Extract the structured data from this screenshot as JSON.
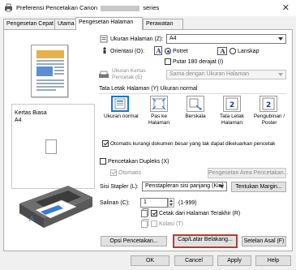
{
  "window": {
    "title_prefix": "Preferensi Pencetakan Canon",
    "title_suffix": "series",
    "close_glyph": "✕"
  },
  "tabs": [
    {
      "label": "Pengesetan Cepat"
    },
    {
      "label": "Utama"
    },
    {
      "label": "Pengesetan Halaman"
    },
    {
      "label": "Perawatan"
    }
  ],
  "preview": {
    "media_line1": "Kertas Biasa",
    "media_line2": "A4"
  },
  "page_setup": {
    "page_size_label": "Ukuran Halaman",
    "page_size_key": "(Z):",
    "page_size_value": "A4",
    "orientation_label": "Orientasi",
    "orientation_key": "(O):",
    "portrait_label": "Potret",
    "landscape_label": "Lanskap",
    "rotate_label": "Putar 180 derajat",
    "rotate_key": "(I)",
    "paper_size_label1": "Ukuran Kertas",
    "paper_size_label2": "Pencetak (E)",
    "paper_size_value": "Sama dengan Ukuran Halaman",
    "layout_heading": "Tata Letak Halaman",
    "layout_key": "(Y)",
    "layout_current": "Ukuran normal",
    "layouts": [
      {
        "label": "Ukuran normal",
        "label2": ""
      },
      {
        "label": "Pas ke",
        "label2": "Halaman"
      },
      {
        "label": "Berskala",
        "label2": ""
      },
      {
        "label": "Tata Letak",
        "label2": "Halaman"
      },
      {
        "label": "Pengubinan /",
        "label2": "Poster"
      }
    ],
    "auto_reduce_label": "Otomatis kurangi dokumen besar yang tak dapat dikeluarkan pencetak",
    "duplex_label": "Pencetakan Dupleks",
    "duplex_key": "(X)",
    "duplex_auto_label": "Otomatis",
    "duplex_area_button": "Pengesetan Area Pencetakan...",
    "stapling_label": "Sisi Stapler",
    "stapling_key": "(L):",
    "stapling_value": "Penstapleran sisi panjang (Kiri)",
    "margin_button": "Tentukan Margin...",
    "copies_label": "Salinan",
    "copies_key": "(C):",
    "copies_value": "1",
    "copies_range": "(1-999)",
    "print_last_label": "Cetak dari Halaman Terakhir",
    "print_last_key": "(R)",
    "collate_label": "Kolasi",
    "collate_key": "(T)",
    "print_options_button": "Opsi Pencetakan...",
    "stamp_button": "Cap/Latar Belakang...",
    "defaults_button": "Setelan Asal",
    "defaults_key": "(F)"
  },
  "footer": {
    "ok": "OK",
    "cancel": "Cancel",
    "apply": "Apply",
    "help": "Help"
  },
  "colors": {
    "accent": "#1976d2",
    "focus_outline": "#c0392b"
  }
}
